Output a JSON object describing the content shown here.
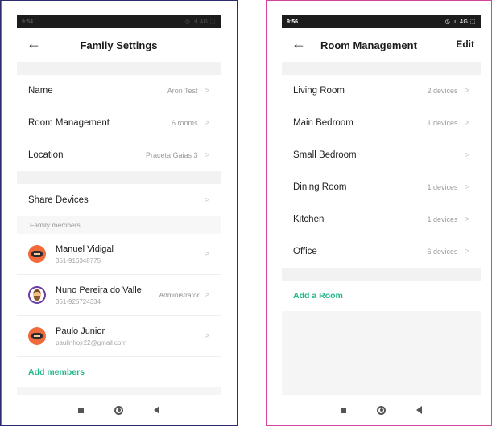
{
  "left_screen": {
    "status": {
      "time": "9:54",
      "icons": "... ◷ .ıl 4G ⬚"
    },
    "header": {
      "title": "Family Settings",
      "back_icon": "back-arrow-icon"
    },
    "rows": [
      {
        "label": "Name",
        "value": "Aron Test"
      },
      {
        "label": "Room Management",
        "value": "6 rooms"
      },
      {
        "label": "Location",
        "value": "Praceta Gaias 3"
      }
    ],
    "share": {
      "label": "Share Devices"
    },
    "members_header": "Family members",
    "members": [
      {
        "name": "Manuel Vidigal",
        "sub": "351-916348775",
        "role": ""
      },
      {
        "name": "Nuno Pereira do Valle",
        "sub": "351-925724334",
        "role": "Administrator"
      },
      {
        "name": "Paulo Junior",
        "sub": "paulinhojr22@gmail.com",
        "role": ""
      }
    ],
    "add_members": "Add members"
  },
  "right_screen": {
    "status": {
      "time": "9:56",
      "icons": "... ◷ .ıl 4G ⬚"
    },
    "header": {
      "title": "Room Management",
      "edit": "Edit",
      "back_icon": "back-arrow-icon"
    },
    "rooms": [
      {
        "label": "Living Room",
        "value": "2 devices"
      },
      {
        "label": "Main Bedroom",
        "value": "1 devices"
      },
      {
        "label": "Small Bedroom",
        "value": ""
      },
      {
        "label": "Dining Room",
        "value": "1 devices"
      },
      {
        "label": "Kitchen",
        "value": "1 devices"
      },
      {
        "label": "Office",
        "value": "6 devices"
      }
    ],
    "add_room": "Add a Room"
  },
  "colors": {
    "accent": "#22b78c",
    "frame": "#d4449c",
    "frame_dark": "#2d2a6e"
  },
  "nav_icons": [
    "recent-apps-icon",
    "home-icon",
    "back-triangle-icon"
  ]
}
